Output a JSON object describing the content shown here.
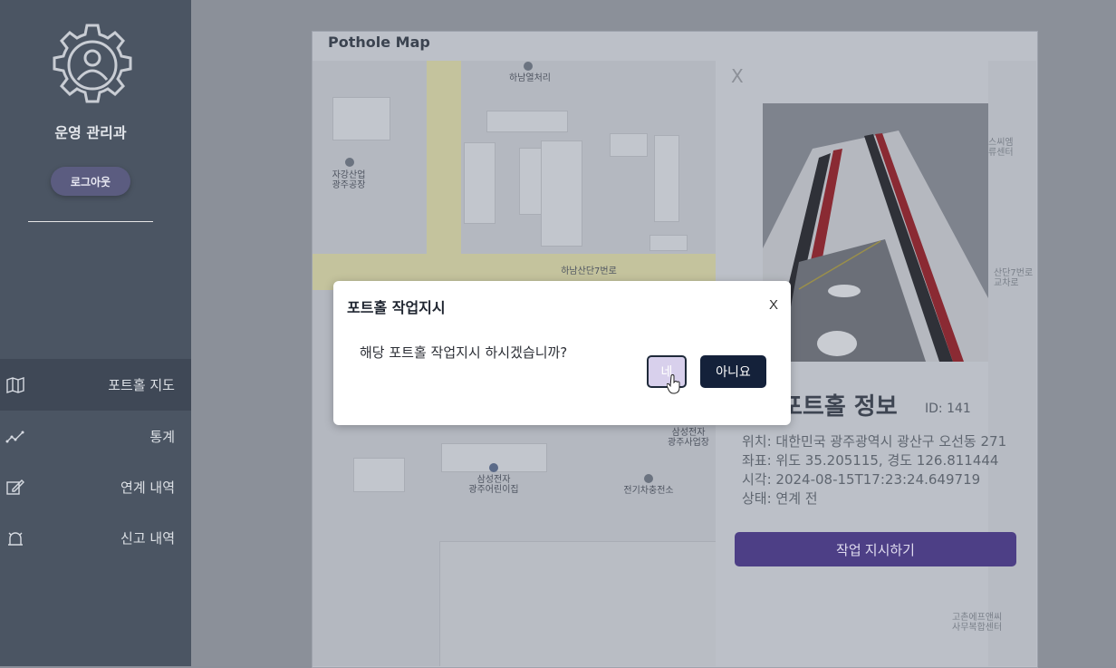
{
  "sidebar": {
    "department": "운영 관리과",
    "logout_label": "로그아웃",
    "nav": [
      {
        "label": "포트홀 지도",
        "icon": "map-icon",
        "active": true
      },
      {
        "label": "통계",
        "icon": "chart-line-icon",
        "active": false
      },
      {
        "label": "연계 내역",
        "icon": "edit-icon",
        "active": false
      },
      {
        "label": "신고 내역",
        "icon": "alarm-icon",
        "active": false
      }
    ]
  },
  "main": {
    "title": "Pothole Map",
    "map_labels": {
      "road_v": "하남산단7번로",
      "place1": "하남열처리",
      "place2": "자강산업\n광주공장",
      "road_h": "하남산단7번로",
      "place3": "삼성전자\n광주사업장",
      "place4": "삼성전자\n광주어린이집",
      "place5": "전기차충전소",
      "right1": "스씨엠\n류센터",
      "right2": "산단7번로\n교차로",
      "right3": "고촌에프앤씨\n사무복합센터"
    },
    "detail": {
      "close_label": "X",
      "title": "포트홀 정보",
      "id": "ID: 141",
      "location": "위치: 대한민국 광주광역시 광산구 오선동 271",
      "coords": "좌표: 위도 35.205115, 경도 126.811444",
      "time": "시각: 2024-08-15T17:23:24.649719",
      "status": "상태: 연계 전",
      "assign_label": "작업 지시하기"
    }
  },
  "modal": {
    "title": "포트홀 작업지시",
    "close_label": "X",
    "message": "해당 포트홀 작업지시 하시겠습니까?",
    "yes_label": "네",
    "no_label": "아니요"
  },
  "colors": {
    "sidebar_bg": "#4b5563",
    "logout_bg": "#5b5c80",
    "assign_btn": "#4d3f86",
    "modal_no_btn": "#14213a",
    "modal_yes_btn": "#d8d0ec"
  }
}
